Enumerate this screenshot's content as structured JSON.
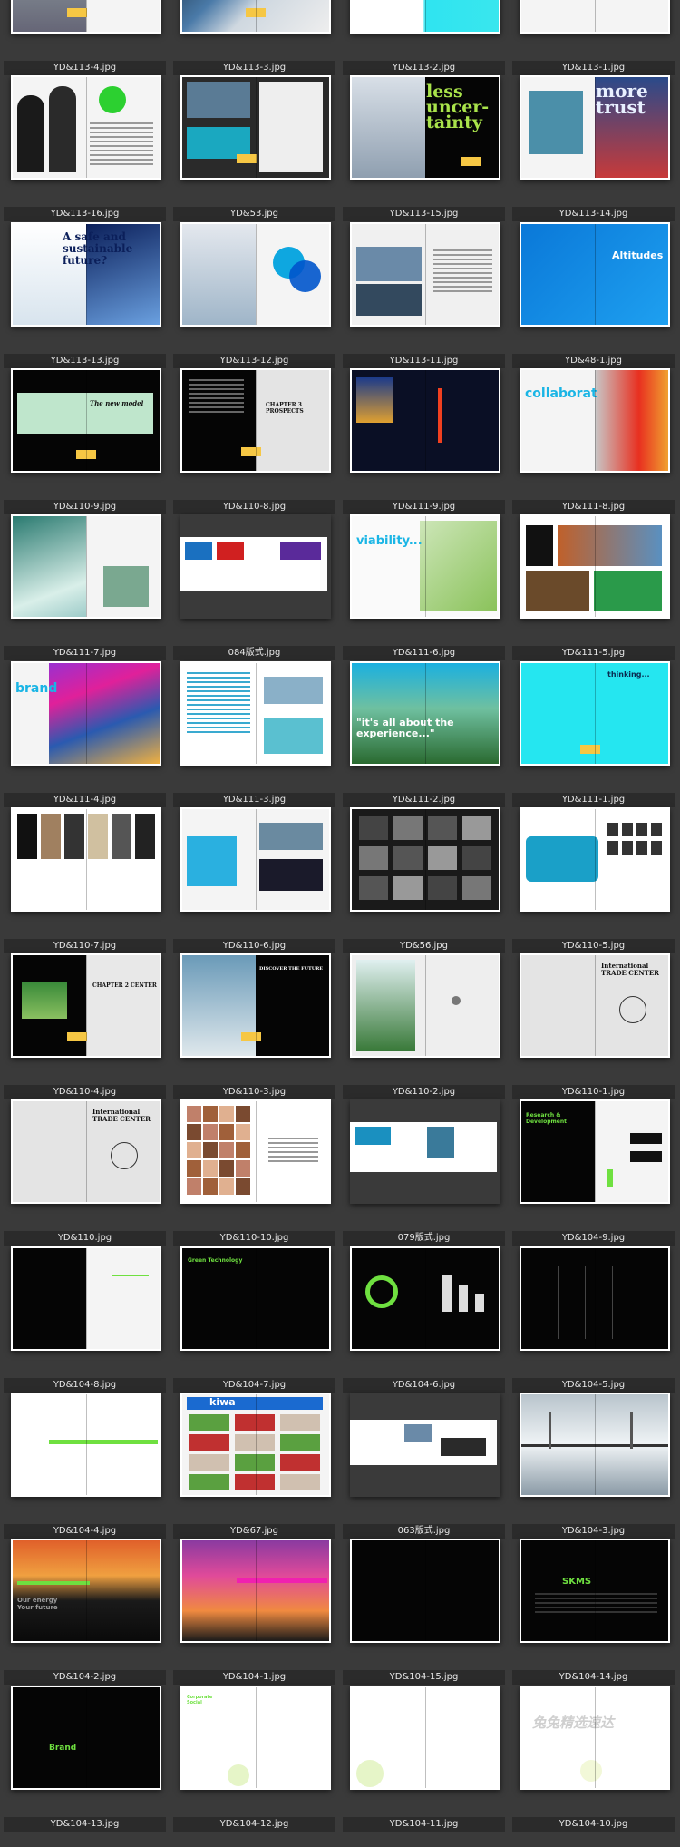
{
  "items": [
    {
      "label": "YD&113-4.jpg",
      "kind": "arch"
    },
    {
      "label": "YD&113-3.jpg",
      "kind": "tower"
    },
    {
      "label": "YD&113-2.jpg",
      "kind": "cyan"
    },
    {
      "label": "YD&113-1.jpg",
      "kind": "blue"
    },
    {
      "label": "YD&113-16.jpg",
      "kind": "people"
    },
    {
      "label": "YD&53.jpg",
      "kind": "dark"
    },
    {
      "label": "YD&113-15.jpg",
      "kind": "less",
      "text": "less uncer- tainty"
    },
    {
      "label": "YD&113-14.jpg",
      "kind": "more",
      "text": "more trust"
    },
    {
      "label": "YD&113-13.jpg",
      "kind": "safe",
      "text": "A safe and sustainable future?"
    },
    {
      "label": "YD&113-12.jpg",
      "kind": "circles"
    },
    {
      "label": "YD&113-11.jpg",
      "kind": "bridge"
    },
    {
      "label": "YD&48-1.jpg",
      "kind": "alt",
      "text": "Altitudes"
    },
    {
      "label": "YD&110-9.jpg",
      "kind": "newmodel",
      "text": "The new model"
    },
    {
      "label": "YD&110-8.jpg",
      "kind": "chapter",
      "text": "CHAPTER 3 PROSPECTS"
    },
    {
      "label": "YD&111-9.jpg",
      "kind": "night"
    },
    {
      "label": "YD&111-8.jpg",
      "kind": "collab",
      "text": "collaborat"
    },
    {
      "label": "YD&111-7.jpg",
      "kind": "eiffel"
    },
    {
      "label": "084版式.jpg",
      "kind": "strip"
    },
    {
      "label": "YD&111-6.jpg",
      "kind": "viab",
      "text": "viability..."
    },
    {
      "label": "YD&111-5.jpg",
      "kind": "collage"
    },
    {
      "label": "YD&111-4.jpg",
      "kind": "brand",
      "text": "brand"
    },
    {
      "label": "YD&111-3.jpg",
      "kind": "resort"
    },
    {
      "label": "YD&111-2.jpg",
      "kind": "exp",
      "text": "\"it's all about the experience...\""
    },
    {
      "label": "YD&111-1.jpg",
      "kind": "think",
      "text": "thinking..."
    },
    {
      "label": "YD&110-7.jpg",
      "kind": "photos"
    },
    {
      "label": "YD&110-6.jpg",
      "kind": "map"
    },
    {
      "label": "YD&56.jpg",
      "kind": "darkgrid"
    },
    {
      "label": "YD&110-5.jpg",
      "kind": "world"
    },
    {
      "label": "YD&110-4.jpg",
      "kind": "itc2",
      "text": "CHAPTER 2 CENTER"
    },
    {
      "label": "YD&110-3.jpg",
      "kind": "sky",
      "text": "DISCOVER THE FUTURE"
    },
    {
      "label": "YD&110-2.jpg",
      "kind": "green"
    },
    {
      "label": "YD&110-1.jpg",
      "kind": "itc",
      "text": "International TRADE CENTER"
    },
    {
      "label": "YD&110.jpg",
      "kind": "itc",
      "text": "International TRADE CENTER"
    },
    {
      "label": "YD&110-10.jpg",
      "kind": "faces"
    },
    {
      "label": "079版式.jpg",
      "kind": "strip2"
    },
    {
      "label": "YD&104-9.jpg",
      "kind": "research",
      "text": "Research & Development"
    },
    {
      "label": "YD&104-8.jpg",
      "kind": "bk1"
    },
    {
      "label": "YD&104-7.jpg",
      "kind": "bk2",
      "text": "Green Technology"
    },
    {
      "label": "YD&104-6.jpg",
      "kind": "bk3"
    },
    {
      "label": "YD&104-5.jpg",
      "kind": "bk4"
    },
    {
      "label": "YD&104-4.jpg",
      "kind": "wt1"
    },
    {
      "label": "YD&67.jpg",
      "kind": "kiwa",
      "text": "kiwa"
    },
    {
      "label": "063版式.jpg",
      "kind": "strip3"
    },
    {
      "label": "YD&104-3.jpg",
      "kind": "gbridge"
    },
    {
      "label": "YD&104-2.jpg",
      "kind": "sunset",
      "text": "Our energy Your future"
    },
    {
      "label": "YD&104-1.jpg",
      "kind": "pink"
    },
    {
      "label": "YD&104-15.jpg",
      "kind": "bk5"
    },
    {
      "label": "YD&104-14.jpg",
      "kind": "skms",
      "text": "SKMS"
    },
    {
      "label": "YD&104-13.jpg",
      "kind": "brandbk",
      "text": "Brand"
    },
    {
      "label": "YD&104-12.jpg",
      "kind": "wt2",
      "text": "Corporate Social"
    },
    {
      "label": "YD&104-11.jpg",
      "kind": "wt3"
    },
    {
      "label": "YD&104-10.jpg",
      "kind": "wt4",
      "text": "兔兔精选速达"
    }
  ]
}
